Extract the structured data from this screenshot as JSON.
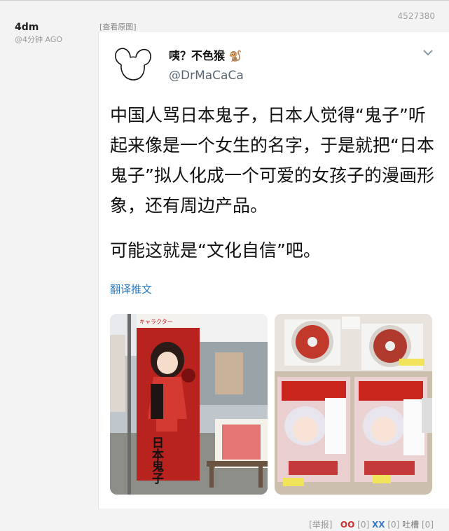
{
  "post": {
    "id": "4527380",
    "author": "4dm",
    "time": "@4分钟 AGO",
    "view_original": "[查看原图]"
  },
  "tweet": {
    "display_name": "咦？不色猴",
    "handle": "@DrMaCaCa",
    "paragraphs": [
      "中国人骂日本鬼子，日本人觉得“鬼子”听起来像是一个女生的名字，于是就把“日本鬼子”拟人化成一个可爱的女孩子的漫画形象，还有周边产品。",
      "可能这就是“文化自信”吧。"
    ],
    "translate_label": "翻译推文",
    "banner_text": "日本鬼子",
    "banner_brand": "キャラクター"
  },
  "footer": {
    "report_label": "[举报]",
    "oo_label": "OO",
    "oo_count": "[0]",
    "xx_label": "XX",
    "xx_count": "[0]",
    "tucao_label": "吐槽",
    "tucao_count": "[0]"
  },
  "icons": {
    "avatar": "mickey-outline-icon",
    "name_suffix": "monkey-icon",
    "menu": "chevron-down-icon"
  },
  "colors": {
    "link": "#2a7cc2",
    "oo": "#d32f2f",
    "xx": "#3a78c4"
  }
}
